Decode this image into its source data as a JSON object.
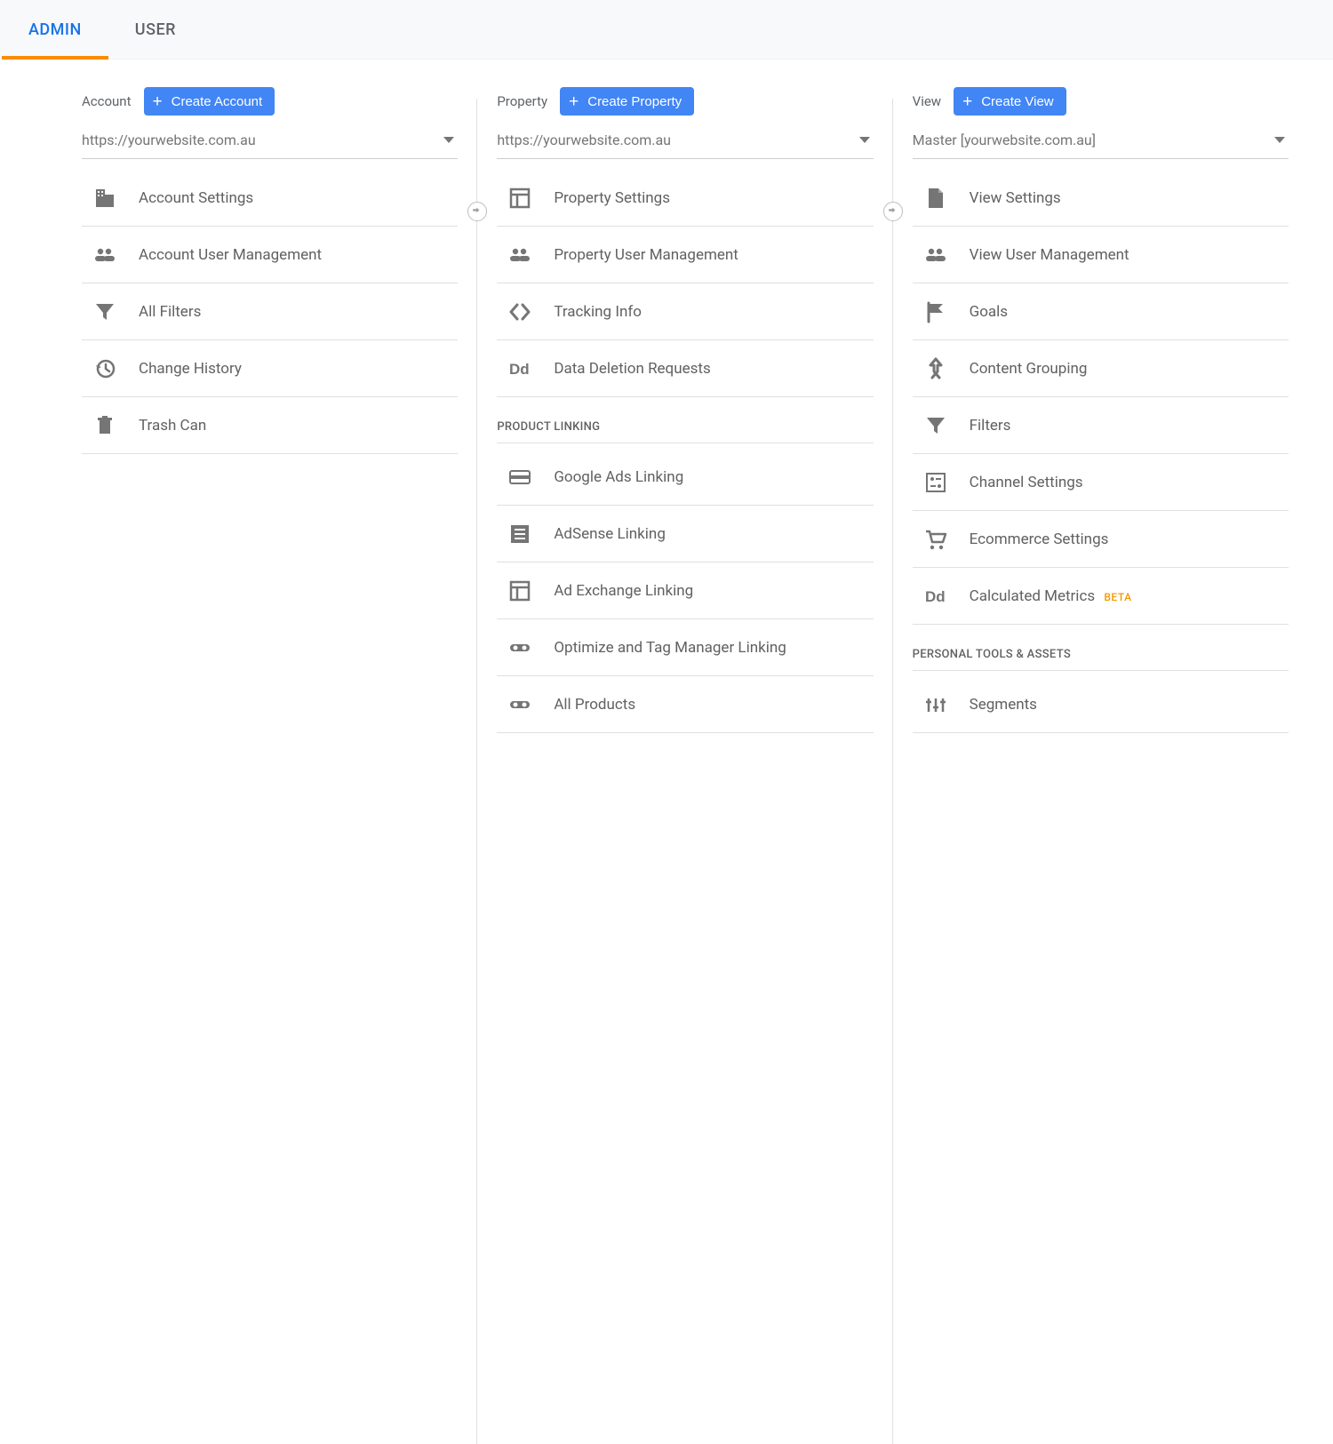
{
  "tabs": {
    "admin": "ADMIN",
    "user": "USER"
  },
  "account": {
    "label": "Account",
    "create": "Create Account",
    "dropdown": "https://yourwebsite.com.au",
    "items": [
      {
        "label": "Account Settings",
        "icon": "building"
      },
      {
        "label": "Account User Management",
        "icon": "people"
      },
      {
        "label": "All Filters",
        "icon": "filter"
      },
      {
        "label": "Change History",
        "icon": "history"
      },
      {
        "label": "Trash Can",
        "icon": "trash"
      }
    ]
  },
  "property": {
    "label": "Property",
    "create": "Create Property",
    "dropdown": "https://yourwebsite.com.au",
    "items": [
      {
        "label": "Property Settings",
        "icon": "layout"
      },
      {
        "label": "Property User Management",
        "icon": "people"
      },
      {
        "label": "Tracking Info",
        "icon": "code"
      },
      {
        "label": "Data Deletion Requests",
        "icon": "dd"
      }
    ],
    "section_product_linking": "PRODUCT LINKING",
    "product_linking": [
      {
        "label": "Google Ads Linking",
        "icon": "card"
      },
      {
        "label": "AdSense Linking",
        "icon": "doclist"
      },
      {
        "label": "Ad Exchange Linking",
        "icon": "layout"
      },
      {
        "label": "Optimize and Tag Manager Linking",
        "icon": "link"
      },
      {
        "label": "All Products",
        "icon": "link"
      }
    ]
  },
  "view": {
    "label": "View",
    "create": "Create View",
    "dropdown": "Master [yourwebsite.com.au]",
    "items": [
      {
        "label": "View Settings",
        "icon": "file"
      },
      {
        "label": "View User Management",
        "icon": "people"
      },
      {
        "label": "Goals",
        "icon": "flag"
      },
      {
        "label": "Content Grouping",
        "icon": "merge"
      },
      {
        "label": "Filters",
        "icon": "filter"
      },
      {
        "label": "Channel Settings",
        "icon": "channels"
      },
      {
        "label": "Ecommerce Settings",
        "icon": "cart"
      },
      {
        "label": "Calculated Metrics",
        "icon": "dd",
        "badge": "BETA"
      }
    ],
    "section_personal": "PERSONAL TOOLS & ASSETS",
    "personal": [
      {
        "label": "Segments",
        "icon": "sliders"
      }
    ]
  }
}
